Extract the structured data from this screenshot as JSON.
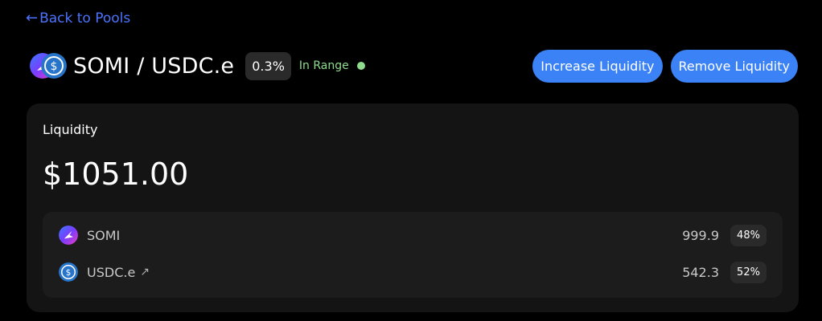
{
  "nav": {
    "back_label": "Back to Pools",
    "back_icon": "left-arrow-icon"
  },
  "header": {
    "pair_title": "SOMI / USDC.e",
    "fee_tier": "0.3%",
    "range_status": "In Range",
    "increase_label": "Increase Liquidity",
    "remove_label": "Remove Liquidity"
  },
  "liquidity": {
    "label": "Liquidity",
    "value": "$1051.00",
    "tokens": [
      {
        "name": "SOMI",
        "icon": "somi-token-icon",
        "amount": "999.9",
        "percent": "48%"
      },
      {
        "name": "USDC.e",
        "icon": "usdc-token-icon",
        "amount": "542.3",
        "percent": "52%",
        "external_link_icon": "external-link-icon"
      }
    ]
  },
  "colors": {
    "background": "#000000",
    "card": "#141414",
    "inner_card": "#1c1c1c",
    "accent_blue": "#3b82f6",
    "link_blue": "#4b73ff",
    "in_range_green": "#8fdc8f"
  }
}
